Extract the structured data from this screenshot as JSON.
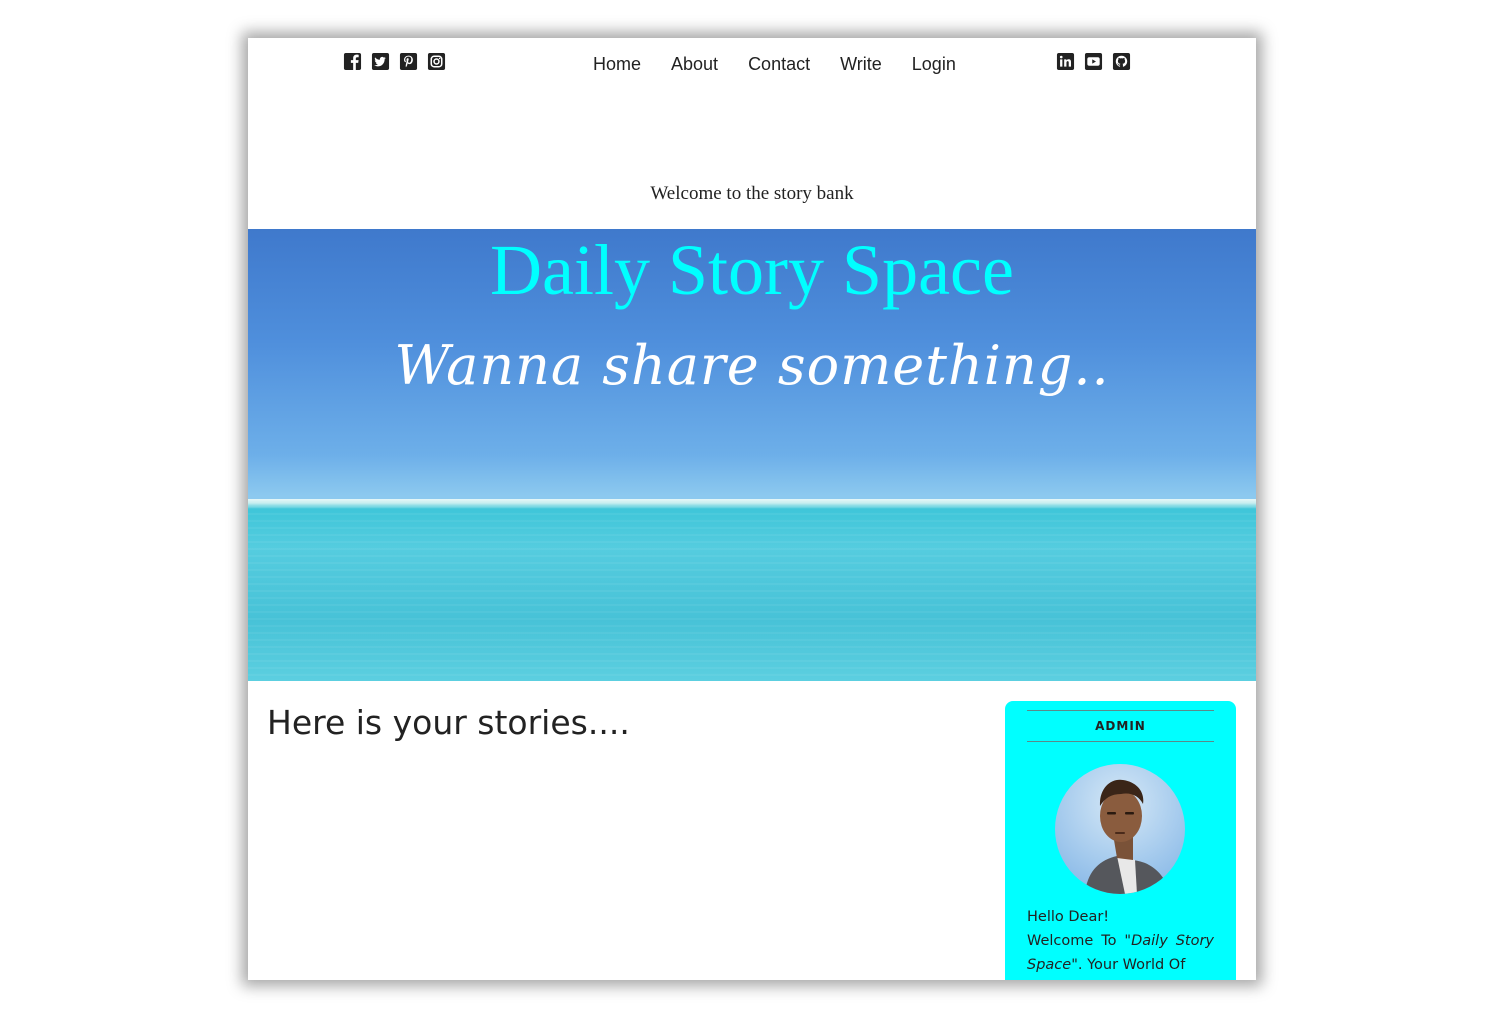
{
  "nav": {
    "social_left": [
      {
        "name": "facebook-icon"
      },
      {
        "name": "twitter-icon"
      },
      {
        "name": "pinterest-icon"
      },
      {
        "name": "instagram-icon"
      }
    ],
    "links": [
      {
        "label": "Home"
      },
      {
        "label": "About"
      },
      {
        "label": "Contact"
      },
      {
        "label": "Write"
      },
      {
        "label": "Login"
      }
    ],
    "social_right": [
      {
        "name": "linkedin-icon"
      },
      {
        "name": "youtube-icon"
      },
      {
        "name": "github-icon"
      }
    ]
  },
  "header": {
    "tagline": "Welcome to the story bank"
  },
  "hero": {
    "title": "Daily Story Space",
    "subtitle": "Wanna share something.."
  },
  "main": {
    "heading": "Here is your stories...."
  },
  "admin": {
    "label": "ADMIN",
    "greeting": "Hello Dear!",
    "welcome_prefix": "Welcome To \"",
    "site_name": "Daily Story Space",
    "welcome_suffix": "\". Your World Of"
  },
  "colors": {
    "accent": "#00ffff",
    "text": "#222222",
    "hero_sky": "#4f8fdc",
    "hero_sea": "#47c2d7"
  }
}
